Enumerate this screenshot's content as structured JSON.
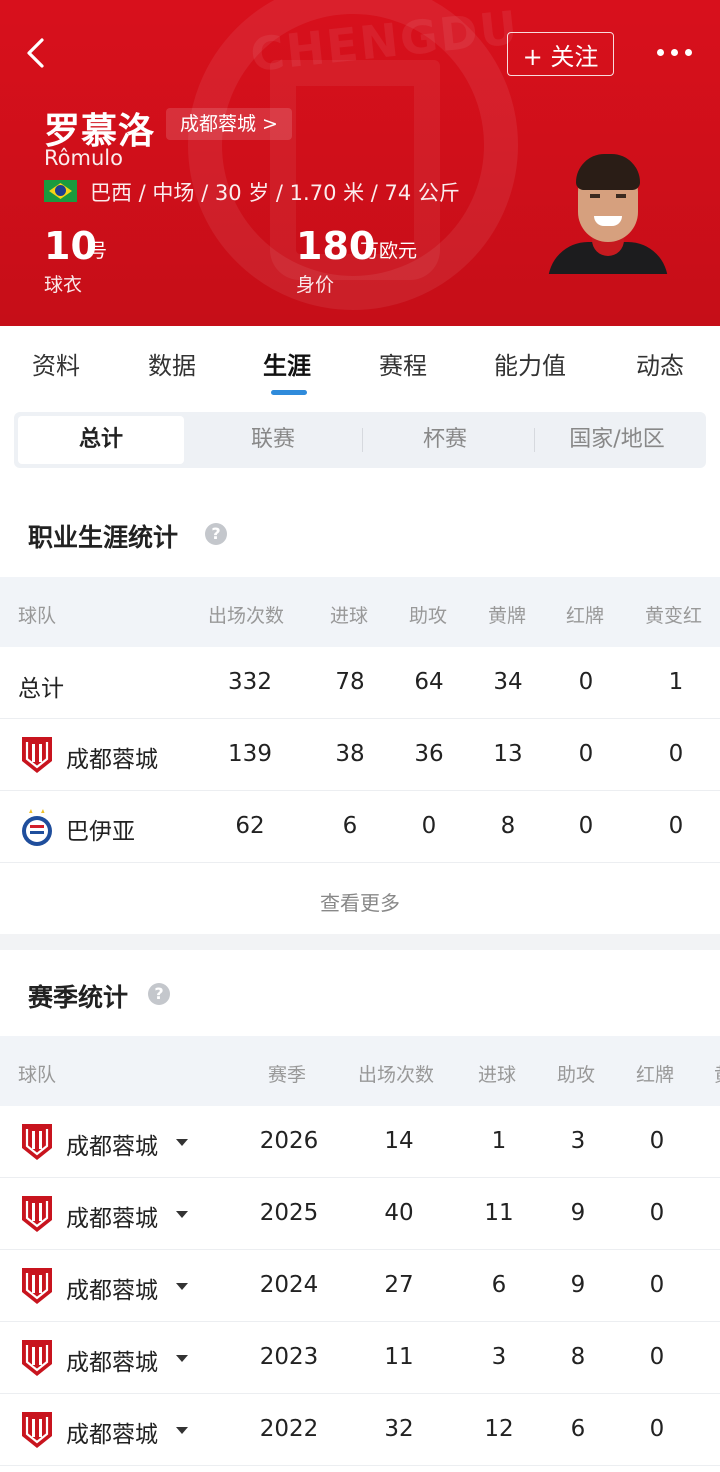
{
  "header": {
    "follow_label": "+ 关注",
    "player_name": "罗慕洛",
    "club_link": "成都蓉城 >",
    "latin_name": "Rômulo",
    "meta": "巴西 / 中场 / 30 岁 / 1.70 米 / 74 公斤",
    "number": "10",
    "number_unit": "号",
    "number_label": "球衣",
    "value": "180",
    "value_unit": "万欧元",
    "value_label": "身价",
    "watermark": "CHENGDU"
  },
  "tabs": [
    "资料",
    "数据",
    "生涯",
    "赛程",
    "能力值",
    "动态"
  ],
  "active_tab": "生涯",
  "subtabs": [
    "总计",
    "联赛",
    "杯赛",
    "国家/地区"
  ],
  "career": {
    "title": "职业生涯统计",
    "help": "?",
    "headers": [
      "球队",
      "出场次数",
      "进球",
      "助攻",
      "黄牌",
      "红牌",
      "黄变红"
    ],
    "rows": [
      {
        "team": "总计",
        "apps": "332",
        "goals": "78",
        "assists": "64",
        "yellow": "34",
        "red": "0",
        "y2r": "1"
      },
      {
        "team": "成都蓉城",
        "apps": "139",
        "goals": "38",
        "assists": "36",
        "yellow": "13",
        "red": "0",
        "y2r": "0"
      },
      {
        "team": "巴伊亚",
        "apps": "62",
        "goals": "6",
        "assists": "0",
        "yellow": "8",
        "red": "0",
        "y2r": "0"
      }
    ],
    "more_label": "查看更多"
  },
  "season": {
    "title": "赛季统计",
    "help": "?",
    "headers": [
      "球队",
      "赛季",
      "出场次数",
      "进球",
      "助攻",
      "红牌",
      "黄"
    ],
    "rows": [
      {
        "team": "成都蓉城",
        "season": "2026",
        "apps": "14",
        "goals": "1",
        "assists": "3",
        "red": "0"
      },
      {
        "team": "成都蓉城",
        "season": "2025",
        "apps": "40",
        "goals": "11",
        "assists": "9",
        "red": "0"
      },
      {
        "team": "成都蓉城",
        "season": "2024",
        "apps": "27",
        "goals": "6",
        "assists": "9",
        "red": "0"
      },
      {
        "team": "成都蓉城",
        "season": "2023",
        "apps": "11",
        "goals": "3",
        "assists": "8",
        "red": "0"
      },
      {
        "team": "成都蓉城",
        "season": "2022",
        "apps": "32",
        "goals": "12",
        "assists": "6",
        "red": "0"
      }
    ]
  },
  "colors": {
    "brand_red": "#d8101c",
    "accent_blue": "#2f8bdb"
  }
}
